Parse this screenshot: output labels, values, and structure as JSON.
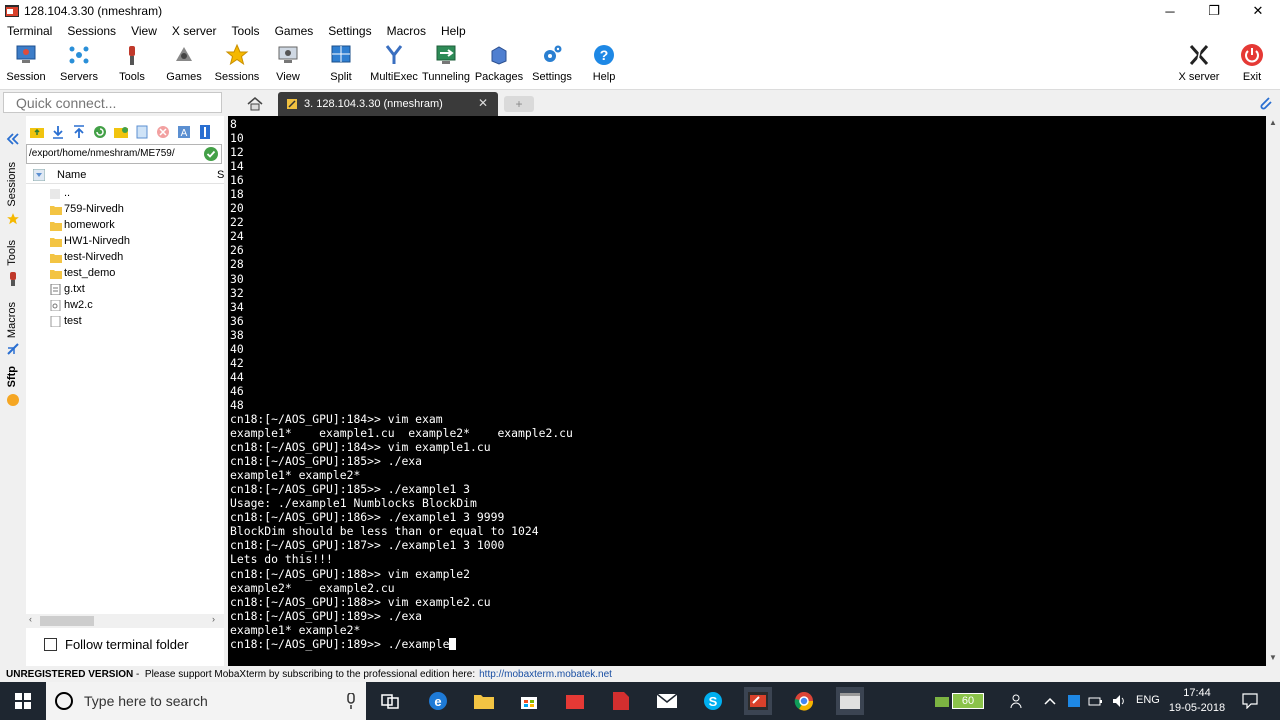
{
  "window": {
    "title": "128.104.3.30 (nmeshram)",
    "minimize": "─",
    "maximize": "❐",
    "close": "✕"
  },
  "menu": [
    "Terminal",
    "Sessions",
    "View",
    "X server",
    "Tools",
    "Games",
    "Settings",
    "Macros",
    "Help"
  ],
  "toolbar": {
    "session": "Session",
    "servers": "Servers",
    "tools": "Tools",
    "games": "Games",
    "sessions": "Sessions",
    "view": "View",
    "split": "Split",
    "multiexec": "MultiExec",
    "tunneling": "Tunneling",
    "packages": "Packages",
    "settings": "Settings",
    "help": "Help",
    "xserver": "X server",
    "exit": "Exit"
  },
  "quick_connect": {
    "placeholder": "Quick connect..."
  },
  "tabs": {
    "session_tab": "3. 128.104.3.30 (nmeshram)",
    "close": "✕",
    "new_tab": "+"
  },
  "side_tabs": [
    "Sessions",
    "Tools",
    "Macros",
    "Sftp"
  ],
  "sftp": {
    "path": "/export/home/nmeshram/ME759/",
    "column_name": "Name",
    "column_s": "S",
    "files": [
      {
        "name": "..",
        "type": "up"
      },
      {
        "name": "759-Nirvedh",
        "type": "folder"
      },
      {
        "name": "homework",
        "type": "folder"
      },
      {
        "name": "HW1-Nirvedh",
        "type": "folder"
      },
      {
        "name": "test-Nirvedh",
        "type": "folder"
      },
      {
        "name": "test_demo",
        "type": "folder"
      },
      {
        "name": "g.txt",
        "type": "file"
      },
      {
        "name": "hw2.c",
        "type": "file"
      },
      {
        "name": "test",
        "type": "file"
      }
    ],
    "follow_label": "Follow terminal folder"
  },
  "terminal": {
    "lines": [
      "8",
      "10",
      "12",
      "14",
      "16",
      "18",
      "20",
      "22",
      "24",
      "26",
      "28",
      "30",
      "32",
      "34",
      "36",
      "38",
      "40",
      "42",
      "44",
      "46",
      "48",
      "cn18:[~/AOS_GPU]:184>> vim exam",
      "example1*    example1.cu  example2*    example2.cu",
      "cn18:[~/AOS_GPU]:184>> vim example1.cu",
      "cn18:[~/AOS_GPU]:185>> ./exa",
      "example1* example2*",
      "cn18:[~/AOS_GPU]:185>> ./example1 3",
      "Usage: ./example1 Numblocks BlockDim",
      "cn18:[~/AOS_GPU]:186>> ./example1 3 9999",
      "BlockDim should be less than or equal to 1024",
      "cn18:[~/AOS_GPU]:187>> ./example1 3 1000",
      "Lets do this!!!",
      "cn18:[~/AOS_GPU]:188>> vim example2",
      "example2*    example2.cu",
      "cn18:[~/AOS_GPU]:188>> vim example2.cu",
      "cn18:[~/AOS_GPU]:189>> ./exa",
      "example1* example2*"
    ],
    "last_line": "cn18:[~/AOS_GPU]:189>> ./example"
  },
  "status": {
    "unregistered": "UNREGISTERED VERSION",
    "message": " -  Please support MobaXterm by subscribing to the professional edition here:",
    "link": "http://mobaxterm.mobatek.net"
  },
  "taskbar": {
    "search_placeholder": "Type here to search",
    "battery": "60",
    "language": "ENG",
    "time": "17:44",
    "date": "19-05-2018"
  },
  "colors": {
    "terminal_bg": "#000000",
    "terminal_fg": "#ffffff",
    "session_tab_bg": "#3a3a3a",
    "taskbar_bg": "#1e2630",
    "link": "#1a4fa3"
  }
}
